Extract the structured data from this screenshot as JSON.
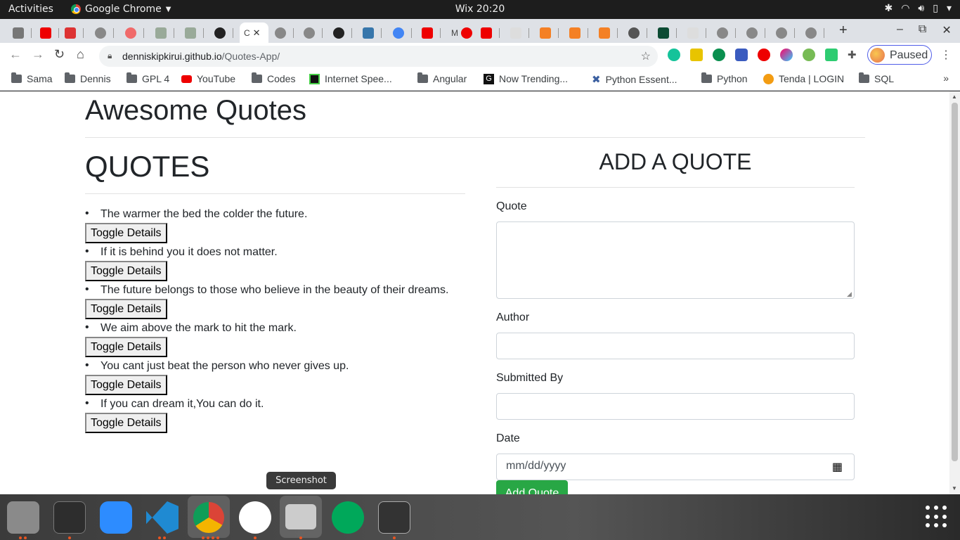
{
  "os_bar": {
    "activities": "Activities",
    "app_name": "Google Chrome",
    "clock": "Wix 20:20"
  },
  "browser": {
    "url_host": "denniskipkirui.github.io",
    "url_path": "/Quotes-App/",
    "profile_status": "Paused",
    "bookmarks": [
      "Sama",
      "Dennis",
      "GPL 4",
      "YouTube",
      "Codes",
      "Internet Spee...",
      "Angular",
      "Now Trending...",
      "Python Essent...",
      "Python",
      "Tenda | LOGIN",
      "SQL"
    ]
  },
  "page": {
    "title": "Awesome Quotes",
    "quotes_heading": "QUOTES",
    "toggle_label": "Toggle Details",
    "quotes": [
      "The warmer the bed the colder the future.",
      "If it is behind you it does not matter.",
      "The future belongs to those who believe in the beauty of their dreams.",
      "We aim above the mark to hit the mark.",
      "You cant just beat the person who never gives up.",
      "If you can dream it,You can do it."
    ],
    "form": {
      "heading": "ADD A QUOTE",
      "quote_label": "Quote",
      "author_label": "Author",
      "submitted_label": "Submitted By",
      "date_label": "Date",
      "date_placeholder": "mm/dd/yyyy",
      "submit_label": "Add Quote"
    }
  },
  "tooltip": "Screenshot",
  "colors": {
    "submit_button": "#28a745",
    "profile_outline": "#4f5de8"
  }
}
